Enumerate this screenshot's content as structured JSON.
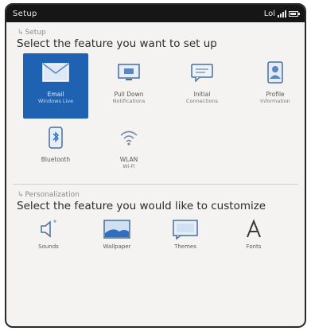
{
  "statusbar": {
    "title": "Setup",
    "right_text": "Lol"
  },
  "section1": {
    "label": "Setup",
    "prompt": "Select the feature you want to set up",
    "tiles": [
      {
        "name": "Email",
        "sub": "Windows Live",
        "icon": "envelope-icon",
        "selected": true
      },
      {
        "name": "Pull Down",
        "sub": "Notifications",
        "icon": "monitor-icon",
        "selected": false
      },
      {
        "name": "Initial",
        "sub": "Connections",
        "icon": "message-icon",
        "selected": false
      },
      {
        "name": "Profile",
        "sub": "Information",
        "icon": "contact-card-icon",
        "selected": false
      },
      {
        "name": "Bluetooth",
        "sub": "",
        "icon": "bluetooth-icon",
        "selected": false
      },
      {
        "name": "WLAN",
        "sub": "Wi-Fi",
        "icon": "wifi-icon",
        "selected": false
      }
    ]
  },
  "section2": {
    "label": "Personalization",
    "prompt": "Select the feature you would like to customize",
    "tools": [
      {
        "name": "Sounds",
        "icon": "speaker-icon"
      },
      {
        "name": "Wallpaper",
        "icon": "landscape-icon"
      },
      {
        "name": "Themes",
        "icon": "screen-icon"
      },
      {
        "name": "Fonts",
        "icon": "font-icon"
      }
    ]
  },
  "colors": {
    "accent": "#1f62b2",
    "statusbar": "#161616",
    "background": "#f4f3f1"
  }
}
